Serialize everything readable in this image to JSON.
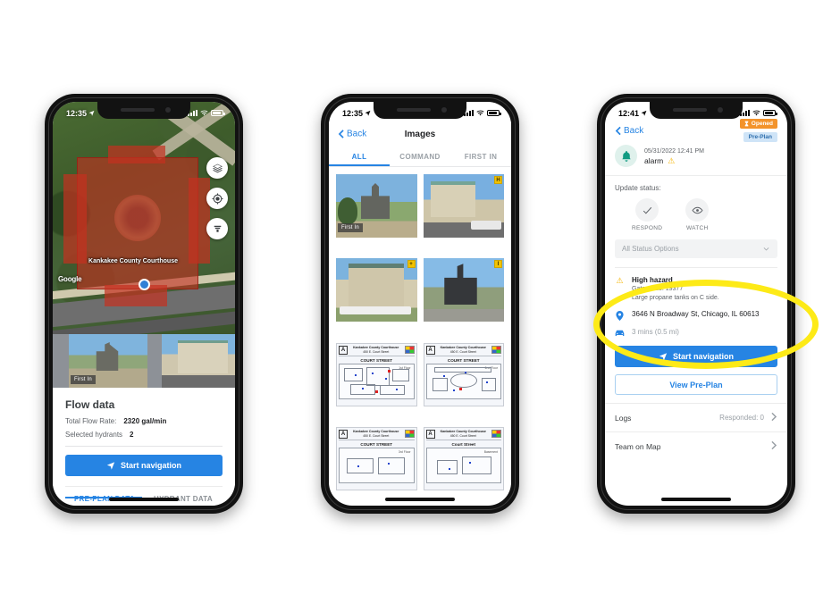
{
  "phone1": {
    "status": {
      "time": "12:35",
      "location_icon": "location-arrow-icon"
    },
    "map": {
      "label": "Kankakee County Courthouse",
      "attribution": "Google",
      "buttons": [
        {
          "name": "layers-icon",
          "label": "Layers"
        },
        {
          "name": "target-icon",
          "label": "Recenter"
        },
        {
          "name": "hydrant-filter-icon",
          "label": "Hydrants"
        }
      ]
    },
    "photos": {
      "first_in_badge": "First In"
    },
    "sheet": {
      "title": "Flow data",
      "rows": [
        {
          "label": "Total Flow Rate:",
          "value": "2320 gal/min"
        },
        {
          "label": "Selected hydrants",
          "value": "2"
        }
      ],
      "primary_button": "Start navigation",
      "tabs": [
        {
          "label": "PRE-PLAN DATA",
          "active": true
        },
        {
          "label": "HYDRANT DATA",
          "active": false
        }
      ]
    }
  },
  "phone2": {
    "status": {
      "time": "12:35"
    },
    "nav": {
      "back": "Back",
      "title": "Images"
    },
    "tabs": [
      {
        "label": "ALL",
        "active": true
      },
      {
        "label": "COMMAND",
        "active": false
      },
      {
        "label": "FIRST IN",
        "active": false
      }
    ],
    "grid": [
      {
        "kind": "photo",
        "variant": "img-court1",
        "badge": "",
        "overlay": "First In"
      },
      {
        "kind": "photo",
        "variant": "img-court2",
        "badge": "H",
        "overlay": ""
      },
      {
        "kind": "photo",
        "variant": "img-court3",
        "badge": "+",
        "overlay": ""
      },
      {
        "kind": "photo",
        "variant": "img-court4",
        "badge": "I",
        "overlay": ""
      },
      {
        "kind": "plan",
        "title": "Kankakee County Courthouse",
        "subtitle": "450 E. Court Street",
        "street": "COURT STREET",
        "floor": "1st Floor"
      },
      {
        "kind": "plan",
        "title": "Kankakee County Courthouse",
        "subtitle": "450 E. Court Street",
        "street": "COURT STREET",
        "floor": "2nd Floor"
      },
      {
        "kind": "plan",
        "title": "Kankakee County Courthouse",
        "subtitle": "450 E. Court Street",
        "street": "COURT STREET",
        "floor": "3rd Floor"
      },
      {
        "kind": "plan",
        "title": "Kankakee County Courthouse",
        "subtitle": "450 E. Court Street",
        "street": "Court Street",
        "floor": "Basement"
      }
    ]
  },
  "phone3": {
    "status": {
      "time": "12:41"
    },
    "nav": {
      "back": "Back"
    },
    "badges": {
      "opened": "Opened",
      "preplan": "Pre-Plan"
    },
    "incident": {
      "datetime": "05/31/2022 12:41 PM",
      "type": "alarm",
      "icon": "bell-icon",
      "warning_icon": "warning-triangle-icon"
    },
    "update_status_label": "Update status:",
    "status_options": [
      {
        "label": "RESPOND",
        "icon": "check-icon"
      },
      {
        "label": "WATCH",
        "icon": "eye-icon"
      }
    ],
    "status_select": {
      "value": "All Status Options"
    },
    "hazard": {
      "title": "High hazard",
      "gate_code": "Gate Code: 19377",
      "note": "Large propane tanks on C side."
    },
    "address": "3646 N Broadway St, Chicago, IL  60613",
    "eta": "3 mins",
    "eta_distance": "(0.5 mi)",
    "primary_button": "Start navigation",
    "secondary_button": "View Pre-Plan",
    "rows": [
      {
        "label": "Logs",
        "meta": "Responded: 0"
      },
      {
        "label": "Team on Map",
        "meta": ""
      }
    ]
  },
  "colors": {
    "accent_blue": "#2684e3",
    "orange_badge": "#f3932b",
    "preplan_badge_bg": "#cfe4f7",
    "highlight_yellow": "#fdea17",
    "hazard_red": "#c43020",
    "bell_teal": "#119b82"
  }
}
